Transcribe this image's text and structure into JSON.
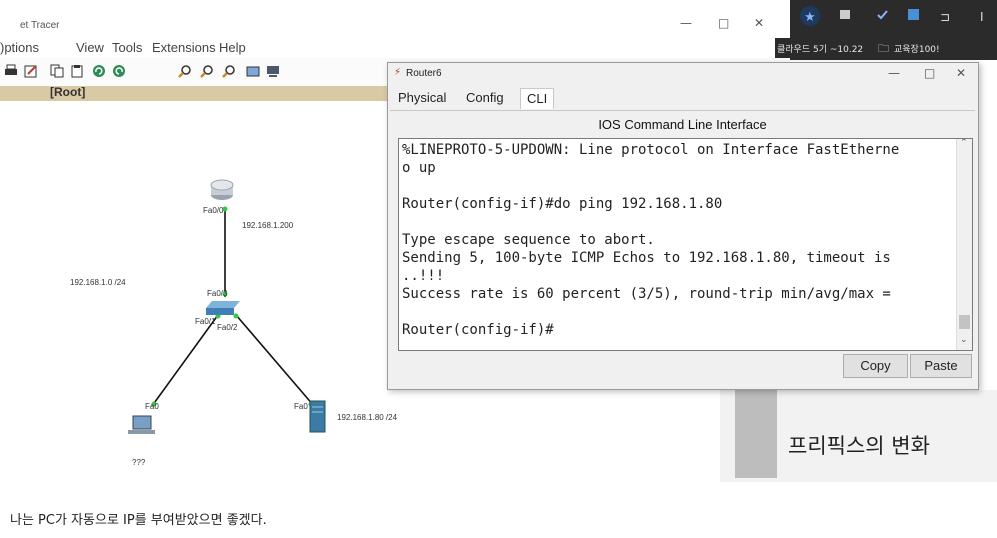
{
  "pt_window": {
    "title": "et Tracer",
    "menu": [
      "Options",
      "View",
      "Tools",
      "Extensions",
      "Help"
    ],
    "menu_visible_first": ")ptions",
    "controls": {
      "minimize": "—",
      "maximize": "□",
      "close": "✕"
    },
    "root_label": "[Root]",
    "topology": {
      "router_port": "Fa0/0",
      "router_ip": "192.168.1.200",
      "network_label": "192.168.1.0 /24",
      "switch_port_top": "Fa0/3",
      "switch_port_left": "Fa0/1",
      "switch_port_right": "Fa0/2",
      "pc_port": "Fa0",
      "server_port": "Fa0",
      "server_ip": "192.168.1.80 /24",
      "pc_label": "???"
    }
  },
  "browser": {
    "bookmark_1": "클라우드 5기 ~10.22",
    "bookmark_2": "교육장100!"
  },
  "router_dialog": {
    "title": "Router6",
    "controls": {
      "minimize": "—",
      "maximize": "□",
      "close": "✕"
    },
    "tabs": [
      "Physical",
      "Config",
      "CLI"
    ],
    "active_tab": "CLI",
    "header": "IOS Command Line Interface",
    "console_lines": [
      "%LINEPROTO-5-UPDOWN: Line protocol on Interface FastEtherne",
      "o up",
      "",
      "Router(config-if)#do ping 192.168.1.80",
      "",
      "Type escape sequence to abort.",
      "Sending 5, 100-byte ICMP Echos to 192.168.1.80, timeout is",
      "..!!!",
      "Success rate is 60 percent (3/5), round-trip min/avg/max =",
      "",
      "Router(config-if)#"
    ],
    "copy_label": "Copy",
    "paste_label": "Paste"
  },
  "blog": {
    "heading": "프리픽스의 변화",
    "caption": "나는 PC가 자동으로 IP를 부여받았으면 좋겠다."
  },
  "colors": {
    "root_bar": "#d9c9a4",
    "link_green": "#2ecc40",
    "browser_dark": "#2b2b2b"
  }
}
